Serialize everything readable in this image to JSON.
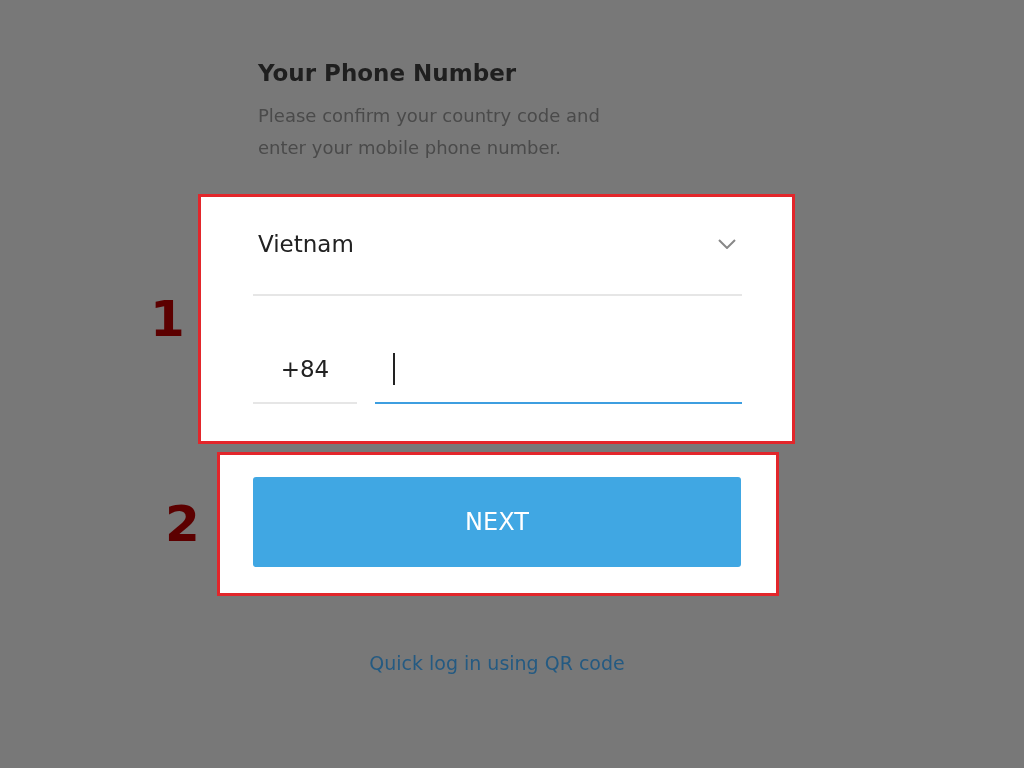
{
  "title": "Your Phone Number",
  "subtitle": "Please confirm your country code and enter your mobile phone number.",
  "country": {
    "value": "Vietnam"
  },
  "code": "+84",
  "phone": {
    "focused": true
  },
  "annotations": [
    {
      "number": "1"
    },
    {
      "number": "2"
    }
  ],
  "next_button": "NEXT",
  "qr_link": "Quick log in using QR code"
}
